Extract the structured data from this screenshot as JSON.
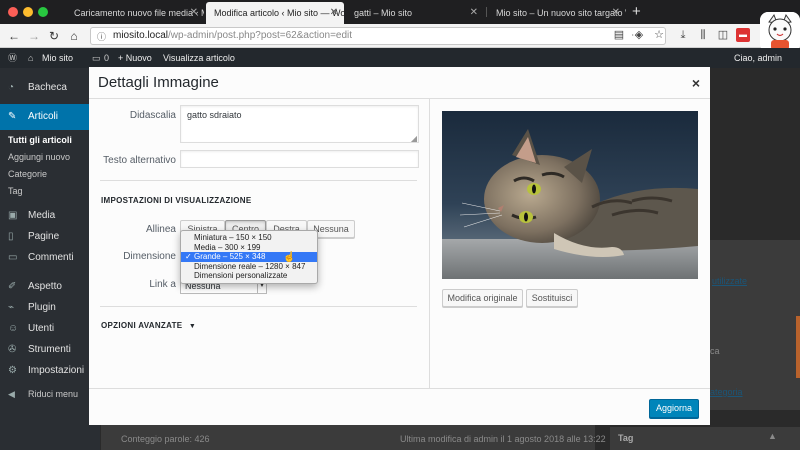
{
  "browser": {
    "tabs": [
      {
        "title": "Caricamento nuovo file media ‹ Mio",
        "active": false
      },
      {
        "title": "Modifica articolo ‹ Mio sito — Word",
        "active": true
      },
      {
        "title": "gatti – Mio sito",
        "active": false
      },
      {
        "title": "Mio sito – Un nuovo sito targato Wo",
        "active": false
      }
    ],
    "url_host": "miosito.local",
    "url_path": "/wp-admin/post.php?post=62&action=edit",
    "new_tab_label": "+"
  },
  "adminbar": {
    "site_name": "Mio sito",
    "comments": "0",
    "new_label": "+ Nuovo",
    "view_label": "Visualizza articolo",
    "greeting": "Ciao, admin"
  },
  "sidebar": {
    "items": [
      {
        "icon": "dashboard-icon",
        "label": "Bacheca"
      },
      {
        "icon": "pin-icon",
        "label": "Articoli"
      },
      {
        "icon": "media-icon",
        "label": "Media"
      },
      {
        "icon": "pages-icon",
        "label": "Pagine"
      },
      {
        "icon": "comments-icon",
        "label": "Commenti"
      },
      {
        "icon": "brush-icon",
        "label": "Aspetto"
      },
      {
        "icon": "plugin-icon",
        "label": "Plugin"
      },
      {
        "icon": "users-icon",
        "label": "Utenti"
      },
      {
        "icon": "tools-icon",
        "label": "Strumenti"
      },
      {
        "icon": "settings-icon",
        "label": "Impostazioni"
      },
      {
        "icon": "collapse-icon",
        "label": "Riduci menu"
      }
    ],
    "submenu": [
      "Tutti gli articoli",
      "Aggiungi nuovo",
      "Categorie",
      "Tag"
    ]
  },
  "background": {
    "word_count": "Conteggio parole: 426",
    "last_modified": "Ultima modifica di admin il 1 agosto 2018 alle 13:22",
    "tag_box": "Tag",
    "used": "utilizzate",
    "category": "ategoria",
    "fragment": "ca"
  },
  "modal": {
    "title": "Dettagli Immagine",
    "caption_label": "Didascalia",
    "caption_value": "gatto sdraiato",
    "alt_label": "Testo alternativo",
    "alt_value": "",
    "display_heading": "IMPOSTAZIONI DI VISUALIZZAZIONE",
    "align_label": "Allinea",
    "align_buttons": [
      "Sinistra",
      "Centro",
      "Destra",
      "Nessuna"
    ],
    "size_label": "Dimensione",
    "link_label": "Link a",
    "link_value": "Nessuna",
    "advanced_label": "OPZIONI AVANZATE",
    "size_options": [
      {
        "label": "Miniatura – 150 × 150",
        "selected": false
      },
      {
        "label": "Media – 300 × 199",
        "selected": false
      },
      {
        "label": "Grande – 525 × 348",
        "selected": true
      },
      {
        "label": "Dimensione reale – 1280 × 847",
        "selected": false
      },
      {
        "label": "Dimensioni personalizzate",
        "selected": false
      }
    ],
    "edit_original": "Modifica originale",
    "replace": "Sostituisci",
    "update": "Aggiorna"
  },
  "colors": {
    "accent": "#0073aa",
    "primary_button": "#0085ba",
    "selection": "#3478f6"
  }
}
